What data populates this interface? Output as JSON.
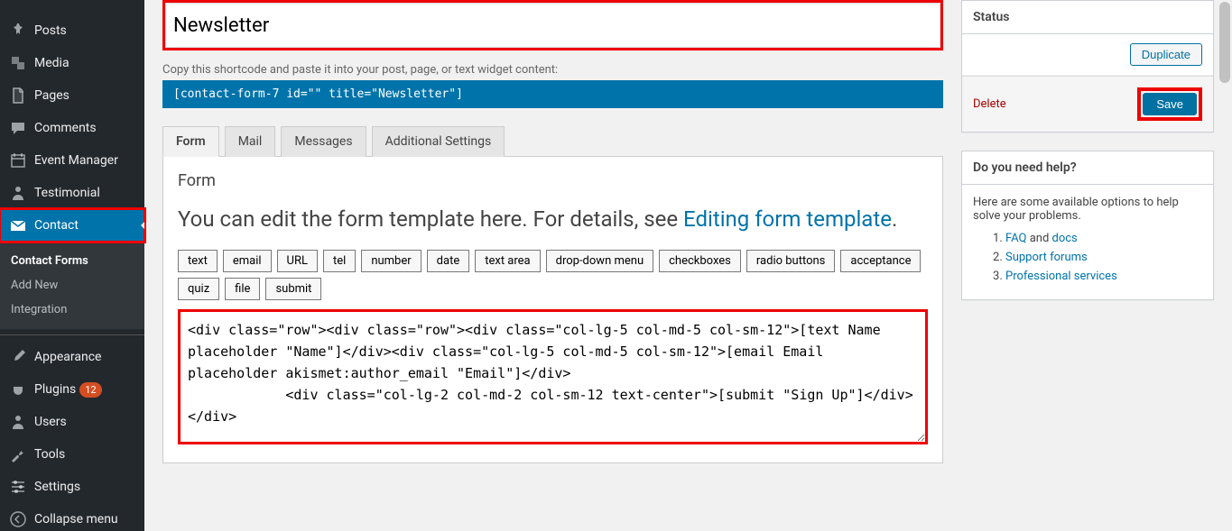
{
  "sidebar": {
    "items": [
      {
        "label": "Posts",
        "icon": "pin"
      },
      {
        "label": "Media",
        "icon": "media"
      },
      {
        "label": "Pages",
        "icon": "page"
      },
      {
        "label": "Comments",
        "icon": "comment"
      },
      {
        "label": "Event Manager",
        "icon": "calendar"
      },
      {
        "label": "Testimonial",
        "icon": "person"
      },
      {
        "label": "Contact",
        "icon": "mail",
        "active": true
      }
    ],
    "contact_sub": [
      {
        "label": "Contact Forms",
        "current": true
      },
      {
        "label": "Add New"
      },
      {
        "label": "Integration"
      }
    ],
    "bottom": [
      {
        "label": "Appearance",
        "icon": "brush"
      },
      {
        "label": "Plugins",
        "icon": "plug",
        "badge": "12"
      },
      {
        "label": "Users",
        "icon": "person"
      },
      {
        "label": "Tools",
        "icon": "wrench"
      },
      {
        "label": "Settings",
        "icon": "sliders"
      },
      {
        "label": "Collapse menu",
        "icon": "collapse"
      }
    ]
  },
  "form": {
    "title_value": "Newsletter",
    "shortcode_hint": "Copy this shortcode and paste it into your post, page, or text widget content:",
    "shortcode": "[contact-form-7 id=\"\" title=\"Newsletter\"]",
    "tabs": [
      "Form",
      "Mail",
      "Messages",
      "Additional Settings"
    ],
    "panel_heading": "Form",
    "panel_desc_pre": "You can edit the form template here. For details, see ",
    "panel_desc_link": "Editing form template",
    "panel_desc_post": ".",
    "tag_buttons": [
      "text",
      "email",
      "URL",
      "tel",
      "number",
      "date",
      "text area",
      "drop-down menu",
      "checkboxes",
      "radio buttons",
      "acceptance",
      "quiz",
      "file",
      "submit"
    ],
    "template_code": "<div class=\"row\"><div class=\"row\"><div class=\"col-lg-5 col-md-5 col-sm-12\">[text Name placeholder \"Name\"]</div><div class=\"col-lg-5 col-md-5 col-sm-12\">[email Email placeholder akismet:author_email \"Email\"]</div>\n            <div class=\"col-lg-2 col-md-2 col-sm-12 text-center\">[submit \"Sign Up\"]</div></div>"
  },
  "status": {
    "heading": "Status",
    "duplicate": "Duplicate",
    "delete": "Delete",
    "save": "Save"
  },
  "help": {
    "heading": "Do you need help?",
    "intro": "Here are some available options to help solve your problems.",
    "items": [
      {
        "prefix": "",
        "link1": "FAQ",
        "mid": " and ",
        "link2": "docs"
      },
      {
        "link1": "Support forums"
      },
      {
        "link1": "Professional services"
      }
    ]
  }
}
